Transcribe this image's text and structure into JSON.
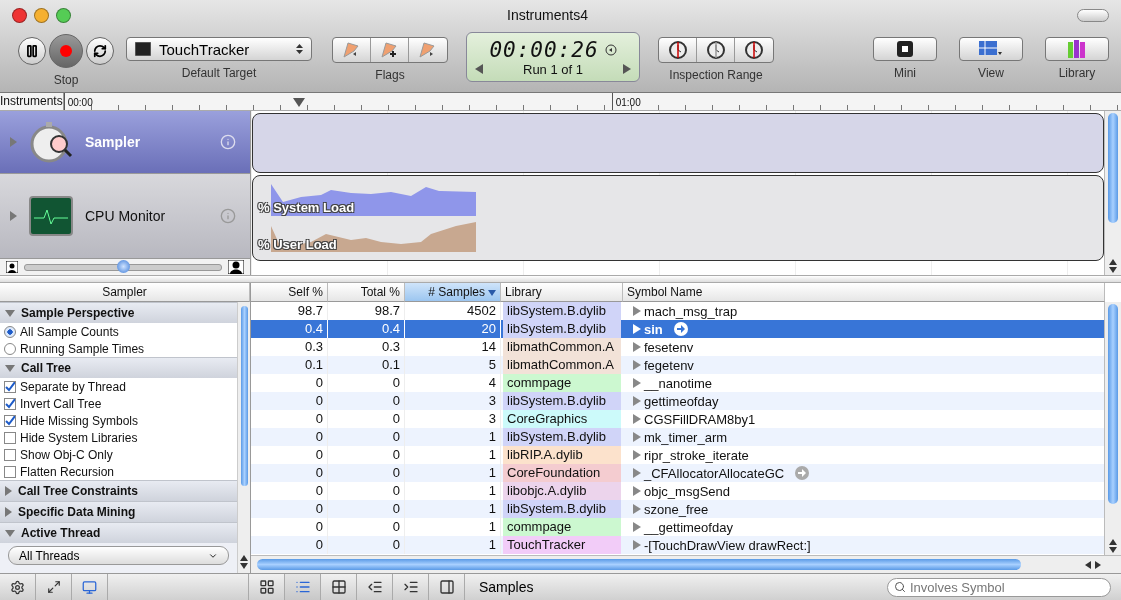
{
  "window": {
    "title": "Instruments4"
  },
  "toolbar": {
    "record": {
      "label": "Stop",
      "recording": true
    },
    "target": {
      "value": "TouchTracker",
      "label": "Default Target"
    },
    "flags": {
      "label": "Flags"
    },
    "timer": {
      "time": "00:00:26",
      "run": "Run 1 of 1"
    },
    "inspection_range": {
      "label": "Inspection Range"
    },
    "buttons": [
      {
        "kind": "mini",
        "label": "Mini"
      },
      {
        "kind": "view",
        "label": "View"
      },
      {
        "kind": "library",
        "label": "Library"
      }
    ]
  },
  "timeline": {
    "header": "Instruments",
    "ticks": [
      "00:00",
      "01:00"
    ]
  },
  "zoom_slider": {
    "level": 0.5
  },
  "instruments": [
    {
      "kind": "sampler",
      "name": "Sampler",
      "selected": true
    },
    {
      "kind": "cpu",
      "name": "CPU Monitor",
      "selected": false,
      "series": [
        "% System Load",
        "% User Load"
      ]
    }
  ],
  "sidebar": {
    "title": "Sampler",
    "sections": [
      {
        "title": "Sample Perspective",
        "expanded": true,
        "options": [
          {
            "kind": "radio",
            "label": "All Sample Counts",
            "selected": true
          },
          {
            "kind": "radio",
            "label": "Running Sample Times",
            "selected": false
          }
        ]
      },
      {
        "title": "Call Tree",
        "expanded": true,
        "options": [
          {
            "kind": "checkbox",
            "label": "Separate by Thread",
            "checked": true
          },
          {
            "kind": "checkbox",
            "label": "Invert Call Tree",
            "checked": true
          },
          {
            "kind": "checkbox",
            "label": "Hide Missing Symbols",
            "checked": true
          },
          {
            "kind": "checkbox",
            "label": "Hide System Libraries",
            "checked": false
          },
          {
            "kind": "checkbox",
            "label": "Show Obj-C Only",
            "checked": false
          },
          {
            "kind": "checkbox",
            "label": "Flatten Recursion",
            "checked": false
          }
        ]
      },
      {
        "title": "Call Tree Constraints",
        "expanded": false
      },
      {
        "title": "Specific Data Mining",
        "expanded": false
      },
      {
        "title": "Active Thread",
        "expanded": true,
        "select": "All Threads"
      }
    ]
  },
  "table": {
    "columns": [
      {
        "label": "Self %",
        "sorted": false
      },
      {
        "label": "Total %",
        "sorted": false
      },
      {
        "label": "# Samples",
        "sorted": true
      },
      {
        "label": "Library",
        "sorted": false
      },
      {
        "label": "Symbol Name",
        "sorted": false
      }
    ],
    "rows": [
      {
        "self": "98.7",
        "total": "98.7",
        "samples": "4502",
        "library": "libSystem.B.dylib",
        "color": "#d0d4f8",
        "symbol": "mach_msg_trap",
        "selected": false,
        "focus": false
      },
      {
        "self": "0.4",
        "total": "0.4",
        "samples": "20",
        "library": "libSystem.B.dylib",
        "color": "#d0d4f8",
        "symbol": "sin",
        "selected": true,
        "focus": true
      },
      {
        "self": "0.3",
        "total": "0.3",
        "samples": "14",
        "library": "libmathCommon.A",
        "color": "#f2e2d8",
        "symbol": "fesetenv",
        "selected": false,
        "focus": false
      },
      {
        "self": "0.1",
        "total": "0.1",
        "samples": "5",
        "library": "libmathCommon.A",
        "color": "#f2e2d8",
        "symbol": "fegetenv",
        "selected": false,
        "focus": false
      },
      {
        "self": "0",
        "total": "0",
        "samples": "4",
        "library": "commpage",
        "color": "#ccf8d0",
        "symbol": "__nanotime",
        "selected": false,
        "focus": false
      },
      {
        "self": "0",
        "total": "0",
        "samples": "3",
        "library": "libSystem.B.dylib",
        "color": "#d0d4f8",
        "symbol": "gettimeofday",
        "selected": false,
        "focus": false
      },
      {
        "self": "0",
        "total": "0",
        "samples": "3",
        "library": "CoreGraphics",
        "color": "#ccfafa",
        "symbol": "CGSFillDRAM8by1",
        "selected": false,
        "focus": false
      },
      {
        "self": "0",
        "total": "0",
        "samples": "1",
        "library": "libSystem.B.dylib",
        "color": "#d0d4f8",
        "symbol": "mk_timer_arm",
        "selected": false,
        "focus": false
      },
      {
        "self": "0",
        "total": "0",
        "samples": "1",
        "library": "libRIP.A.dylib",
        "color": "#fce2cc",
        "symbol": "ripr_stroke_iterate",
        "selected": false,
        "focus": false
      },
      {
        "self": "0",
        "total": "0",
        "samples": "1",
        "library": "CoreFoundation",
        "color": "#f4ccd0",
        "symbol": "_CFAllocatorAllocateGC",
        "selected": false,
        "focus": true
      },
      {
        "self": "0",
        "total": "0",
        "samples": "1",
        "library": "libobjc.A.dylib",
        "color": "#ecd4ec",
        "symbol": "objc_msgSend",
        "selected": false,
        "focus": false
      },
      {
        "self": "0",
        "total": "0",
        "samples": "1",
        "library": "libSystem.B.dylib",
        "color": "#d0d4f8",
        "symbol": "szone_free",
        "selected": false,
        "focus": false
      },
      {
        "self": "0",
        "total": "0",
        "samples": "1",
        "library": "commpage",
        "color": "#ccf8d0",
        "symbol": "__gettimeofday",
        "selected": false,
        "focus": false
      },
      {
        "self": "0",
        "total": "0",
        "samples": "1",
        "library": "TouchTracker",
        "color": "#f2ccf8",
        "symbol": "-[TouchDrawView drawRect:]",
        "selected": false,
        "focus": false
      }
    ]
  },
  "bottom_bar": {
    "view_modes": [
      {
        "kind": "grid",
        "selected": false
      },
      {
        "kind": "list",
        "selected": true
      },
      {
        "kind": "tiles",
        "selected": false
      },
      {
        "kind": "outdent",
        "selected": false
      },
      {
        "kind": "indent",
        "selected": false
      },
      {
        "kind": "panel",
        "selected": false
      }
    ],
    "breadcrumb": "Samples",
    "search": {
      "placeholder": "Involves Symbol"
    }
  }
}
